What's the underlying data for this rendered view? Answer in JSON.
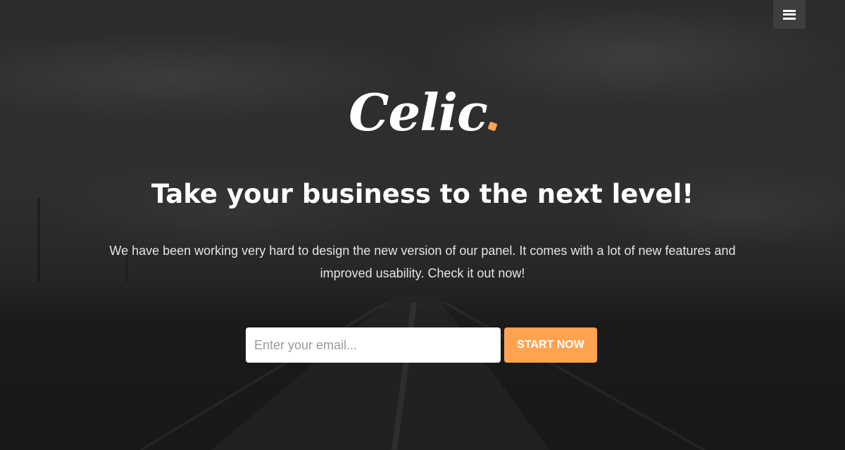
{
  "nav": {
    "menu_icon": "hamburger-menu-icon"
  },
  "logo": {
    "text": "Celic",
    "dot_color": "#ffa351"
  },
  "hero": {
    "headline": "Take your business to the next level!",
    "intro": "We have been working very hard to design the new version of our panel. It comes with a lot of new features and improved usability. Check it out now!"
  },
  "signup": {
    "email_placeholder": "Enter your email...",
    "email_value": "",
    "submit_label": "START NOW"
  },
  "colors": {
    "accent": "#ffa351",
    "text": "#ffffff",
    "menu_background": "#3e3e3e"
  }
}
